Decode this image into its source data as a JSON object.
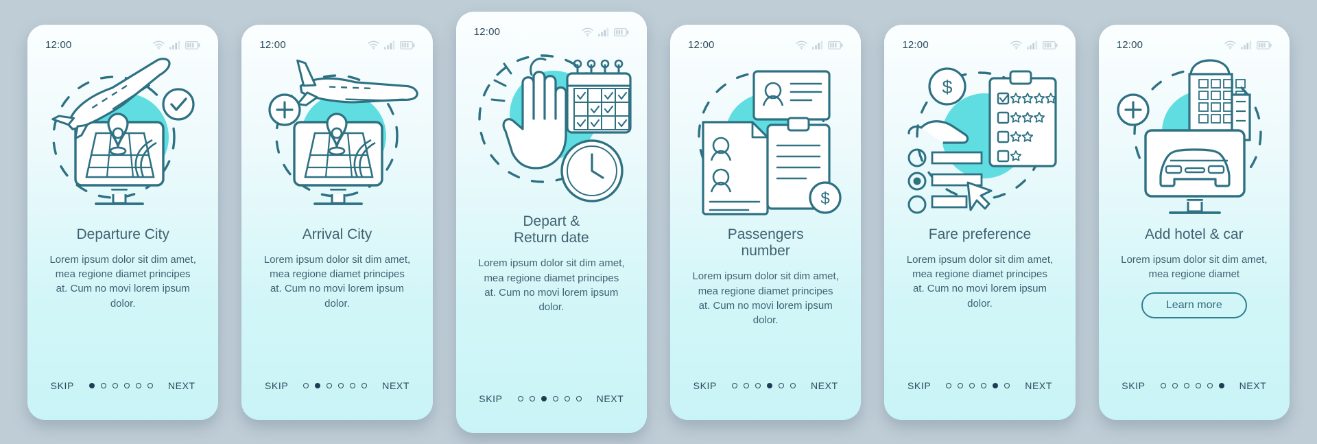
{
  "screens": [
    {
      "clock": "12:00",
      "title": "Departure City",
      "desc": "Lorem ipsum dolor sit dim amet, mea regione diamet principes at. Cum no movi lorem ipsum dolor.",
      "skip_label": "SKIP",
      "next_label": "NEXT",
      "dot_count": 6,
      "active_dot": 1,
      "illustration": "airplane-map-monitor-check-icon",
      "has_learn_more": false,
      "learn_more_label": ""
    },
    {
      "clock": "12:00",
      "title": "Arrival City",
      "desc": "Lorem ipsum dolor sit dim amet, mea regione diamet principes at. Cum no movi lorem ipsum dolor.",
      "skip_label": "SKIP",
      "next_label": "NEXT",
      "dot_count": 6,
      "active_dot": 2,
      "illustration": "airplane-landing-map-monitor-plus-icon",
      "has_learn_more": false,
      "learn_more_label": ""
    },
    {
      "clock": "12:00",
      "title": "Depart &\nReturn date",
      "desc": "Lorem ipsum dolor sit dim amet, mea regione diamet principes at. Cum no movi lorem ipsum dolor.",
      "skip_label": "SKIP",
      "next_label": "NEXT",
      "dot_count": 6,
      "active_dot": 3,
      "illustration": "hand-calendar-clock-icon",
      "has_learn_more": false,
      "learn_more_label": ""
    },
    {
      "clock": "12:00",
      "title": "Passengers\nnumber",
      "desc": "Lorem ipsum dolor sit dim amet, mea regione diamet principes at. Cum no movi lorem ipsum dolor.",
      "skip_label": "SKIP",
      "next_label": "NEXT",
      "dot_count": 6,
      "active_dot": 4,
      "illustration": "passenger-documents-id-cards-icon",
      "has_learn_more": false,
      "learn_more_label": ""
    },
    {
      "clock": "12:00",
      "title": "Fare preference",
      "desc": "Lorem ipsum dolor sit dim amet, mea regione diamet principes at. Cum no movi lorem ipsum dolor.",
      "skip_label": "SKIP",
      "next_label": "NEXT",
      "dot_count": 6,
      "active_dot": 5,
      "illustration": "dollar-hand-rating-checklist-icon",
      "has_learn_more": false,
      "learn_more_label": ""
    },
    {
      "clock": "12:00",
      "title": "Add hotel & car",
      "desc": "Lorem ipsum dolor sit dim amet, mea regione diamet",
      "skip_label": "SKIP",
      "next_label": "NEXT",
      "dot_count": 6,
      "active_dot": 6,
      "illustration": "hotel-car-monitor-plus-icon",
      "has_learn_more": true,
      "learn_more_label": "Learn more"
    }
  ],
  "colors": {
    "background": "#bfcdd6",
    "stroke": "#2e7183",
    "accent": "#5fdde0",
    "text": "#3e6272",
    "nav_text": "#2a4b5e",
    "card_top": "#fbfeff",
    "card_bottom": "#c9f4f7"
  }
}
